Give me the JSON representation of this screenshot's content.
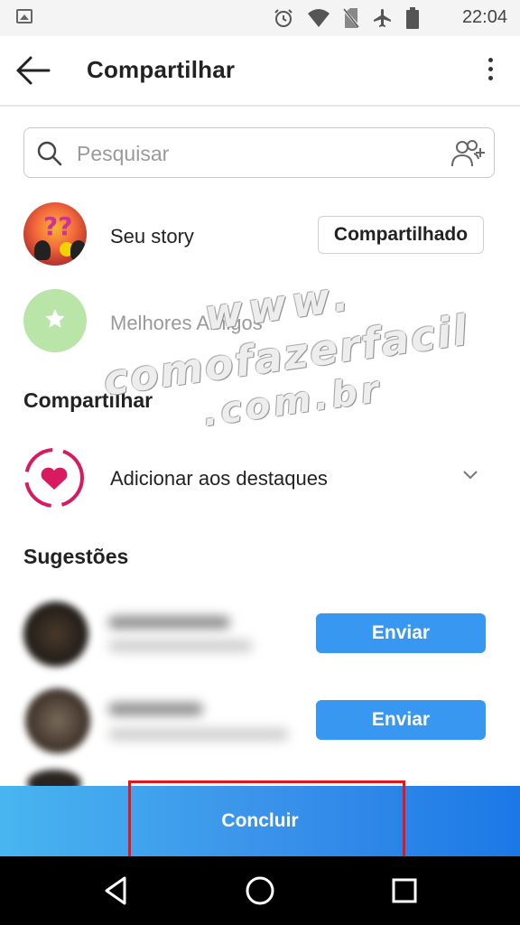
{
  "status_bar": {
    "time": "22:04",
    "icons": [
      "image-icon",
      "alarm-icon",
      "wifi-icon",
      "no-sim-icon",
      "airplane-icon",
      "battery-icon"
    ]
  },
  "header": {
    "title": "Compartilhar",
    "back_icon": "arrow-left-icon",
    "menu_icon": "more-vertical-icon"
  },
  "search": {
    "placeholder": "Pesquisar",
    "value": "",
    "icon": "search-icon",
    "add_icon": "add-user-icon"
  },
  "your_story": {
    "label": "Seu story",
    "button": "Compartilhado"
  },
  "close_friends": {
    "label": "Melhores Amigos",
    "color": "#b9e5a9"
  },
  "share_section": {
    "title": "Compartilhar",
    "highlight_label": "Adicionar aos destaques",
    "highlight_color": "#d81b60"
  },
  "suggestions": {
    "title": "Sugestões",
    "items": [
      {
        "button": "Enviar"
      },
      {
        "button": "Enviar"
      }
    ]
  },
  "watermark": {
    "line1": "www.",
    "line2": "comofazerfacil",
    "line3": ".com.br"
  },
  "bottom_action": {
    "label": "Concluir"
  },
  "colors": {
    "accent": "#3897f0",
    "highlight": "#e3161b"
  }
}
